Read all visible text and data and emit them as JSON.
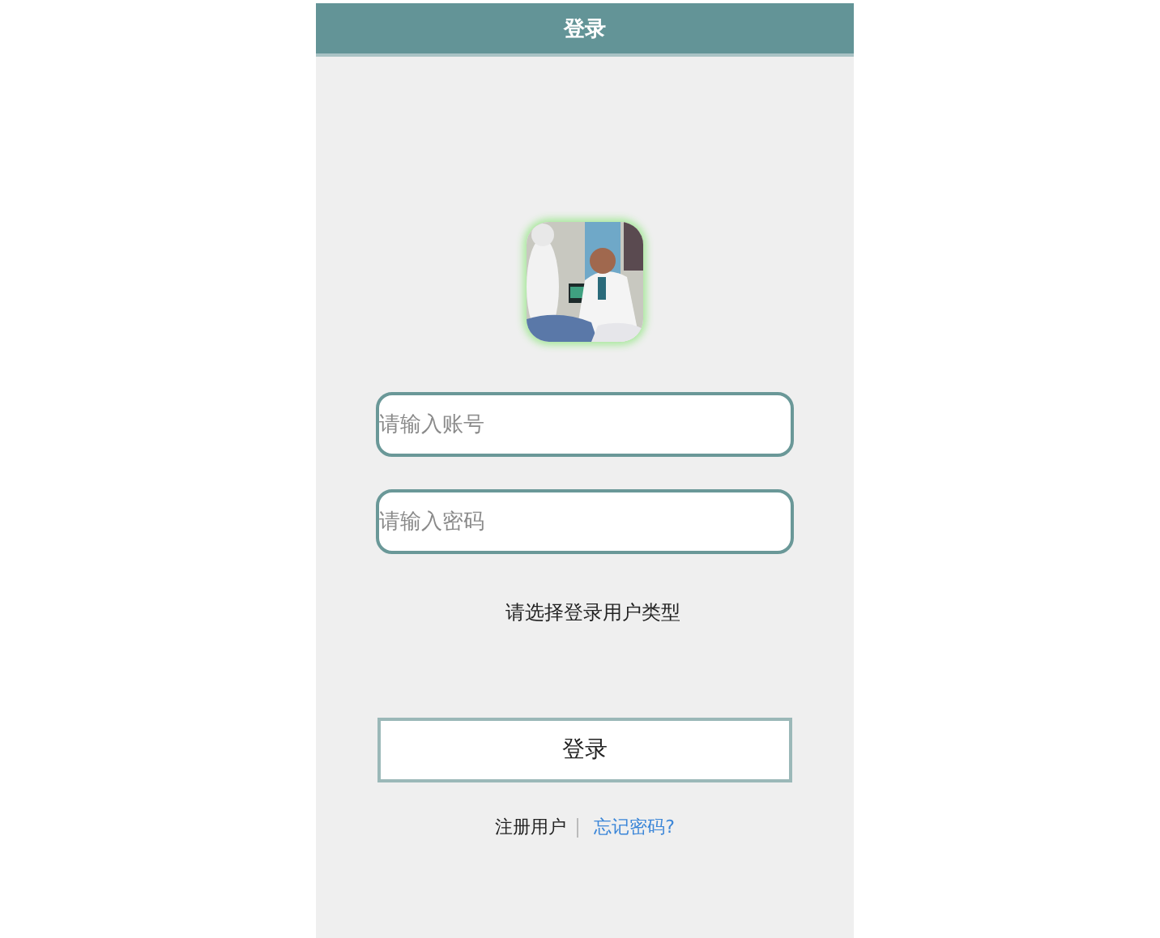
{
  "header": {
    "title": "登录"
  },
  "fields": [
    {
      "placeholder": "请输入账号"
    },
    {
      "placeholder": "请输入密码"
    }
  ],
  "user_type_prompt": "请选择登录用户类型",
  "login_button": "登录",
  "links": [
    {
      "label": "注册用户",
      "kind": "plain"
    },
    {
      "label": "忘记密码?",
      "kind": "link"
    }
  ]
}
